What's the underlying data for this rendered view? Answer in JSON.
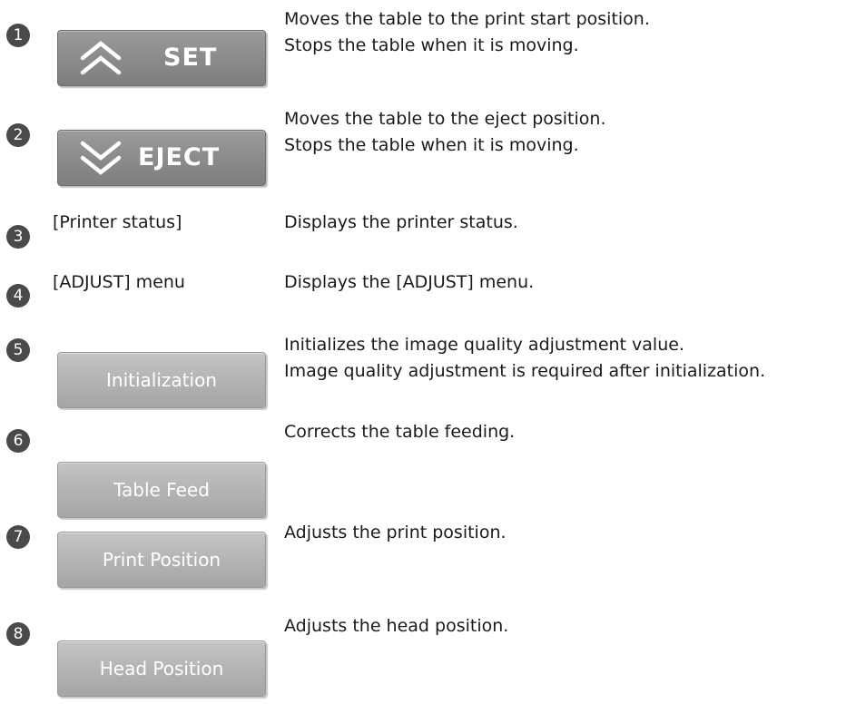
{
  "items": [
    {
      "number": "1",
      "button_label": "SET",
      "description_lines": [
        "Moves the table to the print start position.",
        "Stops the table when it is moving."
      ]
    },
    {
      "number": "2",
      "button_label": "EJECT",
      "description_lines": [
        "Moves the table to the eject position.",
        "Stops the table when it is moving."
      ]
    },
    {
      "number": "3",
      "label": "[Printer status]",
      "description_lines": [
        "Displays the printer status."
      ]
    },
    {
      "number": "4",
      "label": "[ADJUST] menu",
      "description_lines": [
        "Displays the [ADJUST] menu."
      ]
    },
    {
      "number": "5",
      "button_label": "Initialization",
      "description_lines": [
        "Initializes the image quality adjustment value.",
        "Image quality adjustment is required after initialization."
      ]
    },
    {
      "number": "6",
      "button_label": "Table Feed",
      "description_lines": [
        "Corrects the table feeding."
      ]
    },
    {
      "number": "7",
      "button_label": "Print Position",
      "description_lines": [
        "Adjusts the print position."
      ]
    },
    {
      "number": "8",
      "button_label": "Head Position",
      "description_lines": [
        "Adjusts the head position."
      ]
    }
  ]
}
